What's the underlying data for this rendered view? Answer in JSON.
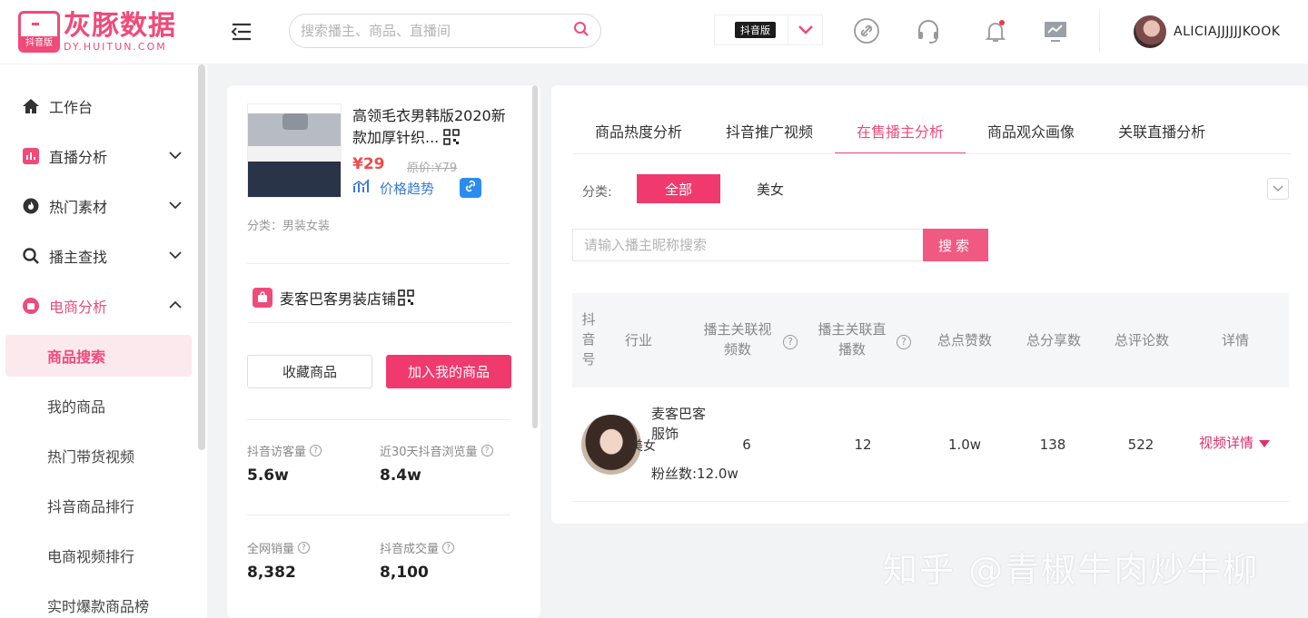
{
  "logo": {
    "name": "灰豚数据",
    "domain": "DY.HUITUN.COM",
    "tag": "抖音版"
  },
  "header": {
    "search_placeholder": "搜索播主、商品、直播间",
    "version_badge": "抖音版",
    "username": "ALICIAJJJJJJKOOK"
  },
  "sidebar": {
    "items": [
      {
        "label": "工作台"
      },
      {
        "label": "直播分析"
      },
      {
        "label": "热门素材"
      },
      {
        "label": "播主查找"
      },
      {
        "label": "电商分析"
      }
    ],
    "sub": [
      {
        "label": "商品搜索"
      },
      {
        "label": "我的商品"
      },
      {
        "label": "热门带货视频"
      },
      {
        "label": "抖音商品排行"
      },
      {
        "label": "电商视频排行"
      },
      {
        "label": "实时爆款商品榜"
      }
    ]
  },
  "product": {
    "title": "高领毛衣男韩版2020新款加厚针织...",
    "price": "¥29",
    "original_price": "原价:¥79",
    "trend_label": "价格趋势",
    "category": "分类：男装女装",
    "shop_name": "麦客巴客男装店铺",
    "fav_button": "收藏商品",
    "add_button": "加入我的商品",
    "stats": [
      {
        "label": "抖音访客量",
        "value": "5.6w"
      },
      {
        "label": "近30天抖音浏览量",
        "value": "8.4w"
      },
      {
        "label": "全网销量",
        "value": "8,382"
      },
      {
        "label": "抖音成交量",
        "value": "8,100"
      }
    ]
  },
  "main": {
    "tabs": [
      "商品热度分析",
      "抖音推广视频",
      "在售播主分析",
      "商品观众画像",
      "关联直播分析"
    ],
    "category_label": "分类:",
    "categories": [
      "全部",
      "美女"
    ],
    "search_placeholder": "请输入播主昵称搜索",
    "search_button": "搜索",
    "table": {
      "headers": {
        "index": "抖\n音\n号",
        "industry": "行业",
        "videos": "播主关联视\n频数",
        "lives": "播主关联直\n播数",
        "likes": "总点赞数",
        "shares": "总分享数",
        "comments": "总评论数",
        "detail": "详情"
      },
      "row": {
        "name": "麦客巴客服饰",
        "industry": "美女",
        "fans": "粉丝数:12.0w",
        "videos": "6",
        "lives": "12",
        "likes": "1.0w",
        "shares": "138",
        "comments": "522",
        "detail_link": "视频详情"
      }
    }
  },
  "watermark": "知乎 @青椒牛肉炒牛柳",
  "colors": {
    "brand": "#f04a7a",
    "accent_button": "#f03a6e",
    "link_blue": "#3a7bd5"
  }
}
